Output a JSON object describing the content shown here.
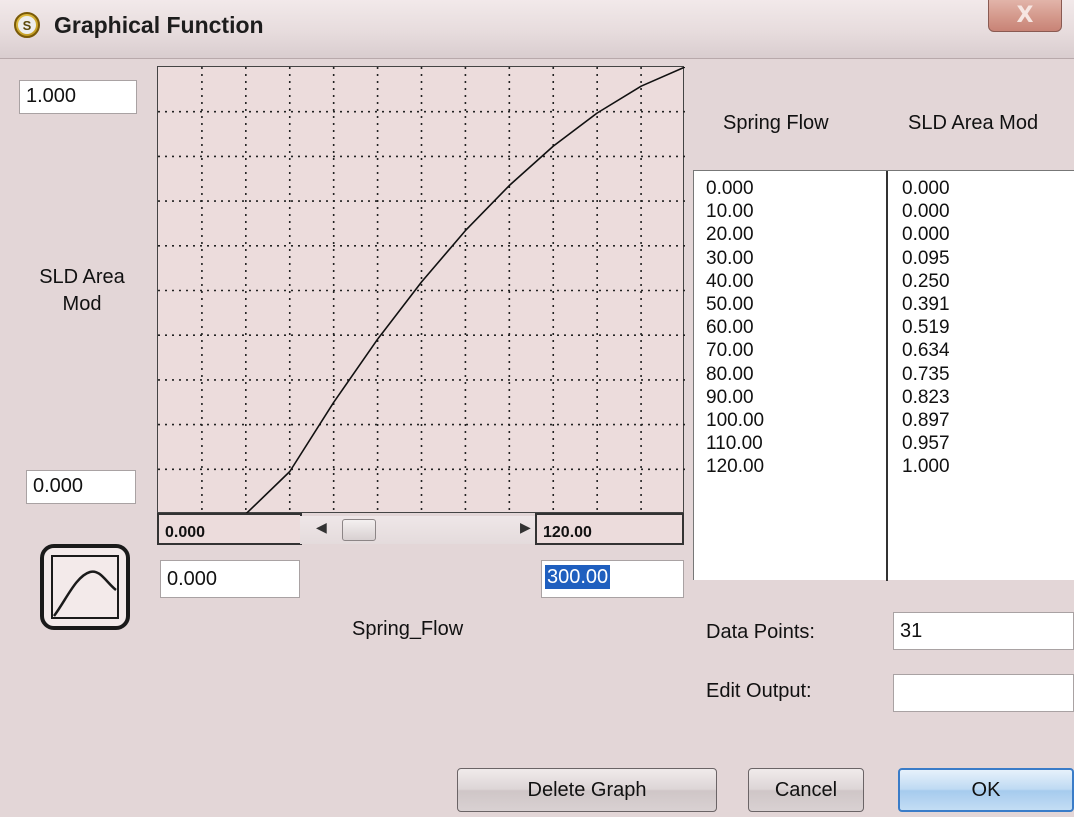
{
  "window": {
    "title": "Graphical Function",
    "app_badge": "S",
    "close_label": "X"
  },
  "graph": {
    "y_max": "1.000",
    "y_min": "0.000",
    "y_label_line1": "SLD Area",
    "y_label_line2": "Mod",
    "x_view_min": "0.000",
    "x_view_max": "120.00",
    "x_min_input": "0.000",
    "x_max_input": "300.00",
    "x_label": "Spring_Flow"
  },
  "chart_data": {
    "type": "line",
    "xlim": [
      0,
      120
    ],
    "ylim": [
      0,
      1
    ],
    "grid": true,
    "series": [
      {
        "x": [
          0,
          10,
          20,
          30,
          40,
          50,
          60,
          70,
          80,
          90,
          100,
          110,
          120
        ],
        "y": [
          0.0,
          0.0,
          0.0,
          0.095,
          0.25,
          0.391,
          0.519,
          0.634,
          0.735,
          0.823,
          0.897,
          0.957,
          1.0
        ]
      }
    ]
  },
  "table": {
    "col1_header": "Spring Flow",
    "col2_header": "SLD Area Mod",
    "x_values": [
      "0.000",
      "10.00",
      "20.00",
      "30.00",
      "40.00",
      "50.00",
      "60.00",
      "70.00",
      "80.00",
      "90.00",
      "100.00",
      "110.00",
      "120.00"
    ],
    "y_values": [
      "0.000",
      "0.000",
      "0.000",
      "0.095",
      "0.250",
      "0.391",
      "0.519",
      "0.634",
      "0.735",
      "0.823",
      "0.897",
      "0.957",
      "1.000"
    ]
  },
  "form": {
    "data_points_label": "Data Points:",
    "data_points_value": "31",
    "edit_output_label": "Edit Output:",
    "edit_output_value": ""
  },
  "buttons": {
    "delete": "Delete Graph",
    "cancel": "Cancel",
    "ok": "OK"
  },
  "colors": {
    "graph_bg": "#ecdcdc",
    "selection": "#1f5fbf",
    "ok_border": "#3a7cc8"
  }
}
